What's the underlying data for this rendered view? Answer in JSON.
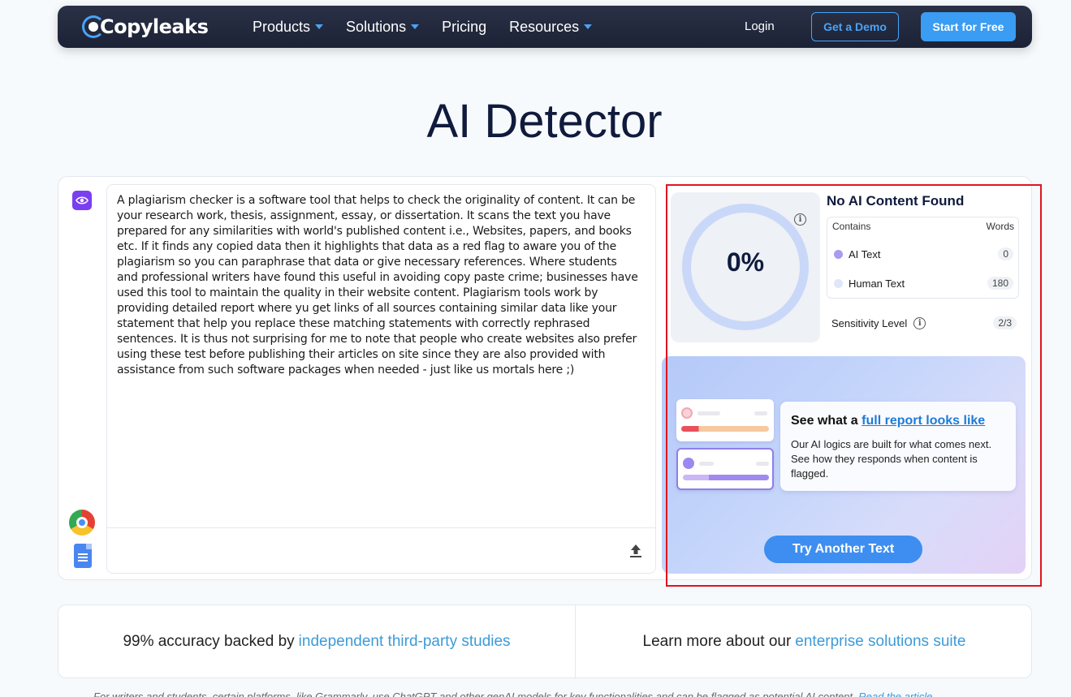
{
  "nav": {
    "logo": "Copyleaks",
    "menu": [
      {
        "label": "Products",
        "has_caret": true
      },
      {
        "label": "Solutions",
        "has_caret": true
      },
      {
        "label": "Pricing",
        "has_caret": false
      },
      {
        "label": "Resources",
        "has_caret": true
      }
    ],
    "login": "Login",
    "demo_label": "Get a Demo",
    "free_label": "Start for Free"
  },
  "page_title": "AI Detector",
  "input": {
    "text": "A plagiarism checker is a software tool that helps to check the originality of content. It can be your research work, thesis, assignment, essay, or dissertation. It scans the text you have prepared for any similarities with world's published content i.e., Websites, papers, and books etc. If it finds any copied data then it highlights that data as a red flag to aware you of the plagiarism so you can paraphrase that data or give necessary references. Where students and professional writers have found this useful in avoiding copy paste crime; businesses have used this tool to maintain the quality in their website content. Plagiarism tools work by providing detailed report where yu get links of all sources containing similar data like your statement that help you replace these matching statements with correctly rephrased sentences. It is thus not surprising for me to note that people who create websites also prefer using these test before publishing their articles on site since they are also provided with assistance from such software packages when needed - just like us mortals here ;)"
  },
  "result": {
    "percent": "0%",
    "title": "No AI Content Found",
    "table_headers": {
      "contains": "Contains",
      "words": "Words"
    },
    "rows": [
      {
        "label": "AI Text",
        "count": "0",
        "color": "#a79cf0"
      },
      {
        "label": "Human Text",
        "count": "180",
        "color": "#dfe6f8"
      }
    ],
    "sensitivity_label": "Sensitivity Level",
    "sensitivity_value": "2/3"
  },
  "promo": {
    "heading_prefix": "See what a",
    "heading_link": "full report looks like",
    "description": "Our AI logics are built for what comes next. See how they responds when content is flagged.",
    "try_label": "Try Another Text"
  },
  "info": {
    "left_text": "99% accuracy backed by",
    "left_link": "independent third-party studies",
    "right_text": "Learn more about our",
    "right_link": "enterprise solutions suite"
  },
  "footnote": {
    "text": "For writers and students, certain platforms, like Grammarly, use ChatGPT and other genAI models for key functionalities and can be flagged as potential AI content.",
    "link": "Read the article"
  },
  "colors": {
    "accent": "#3a9cf2",
    "nav_bg": "#1c2236",
    "highlight": "#e0141f"
  }
}
